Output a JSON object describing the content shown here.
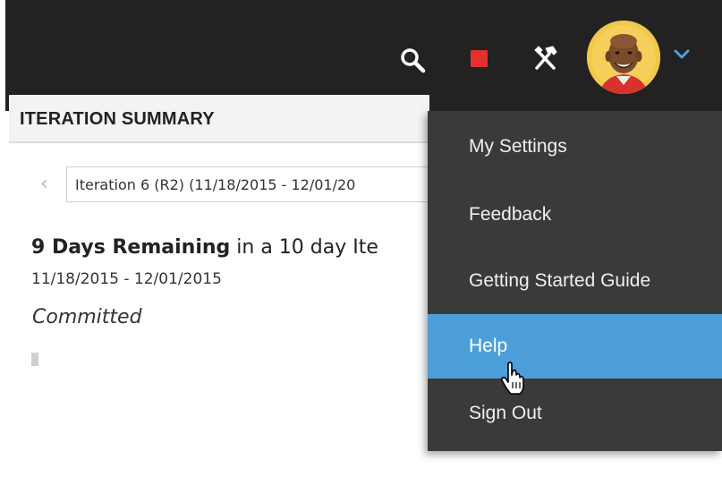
{
  "header": {
    "icons": [
      "search-icon",
      "stop-icon",
      "tools-icon",
      "user-avatar",
      "chevron-down-icon"
    ],
    "colors": {
      "bar": "#222222",
      "stop": "#e5302f",
      "chevron": "#4c9fd8"
    }
  },
  "page": {
    "summary_title": "ITERATION SUMMARY",
    "prev_arrow": "‹",
    "iteration_select_value": "Iteration 6 (R2) (11/18/2015 - 12/01/20",
    "days_remaining_bold": "9 Days Remaining",
    "days_remaining_rest": " in a 10 day Ite",
    "date_range": "11/18/2015 - 12/01/2015",
    "committed_label": "Committed"
  },
  "menu": {
    "items": [
      {
        "label": "My Settings"
      },
      {
        "label": "Feedback"
      },
      {
        "label": "Getting Started Guide"
      },
      {
        "label": "Help",
        "state": "hovered"
      },
      {
        "label": "Sign Out"
      }
    ],
    "colors": {
      "background": "#3a3a3a",
      "highlight": "#4c9fd8"
    }
  }
}
